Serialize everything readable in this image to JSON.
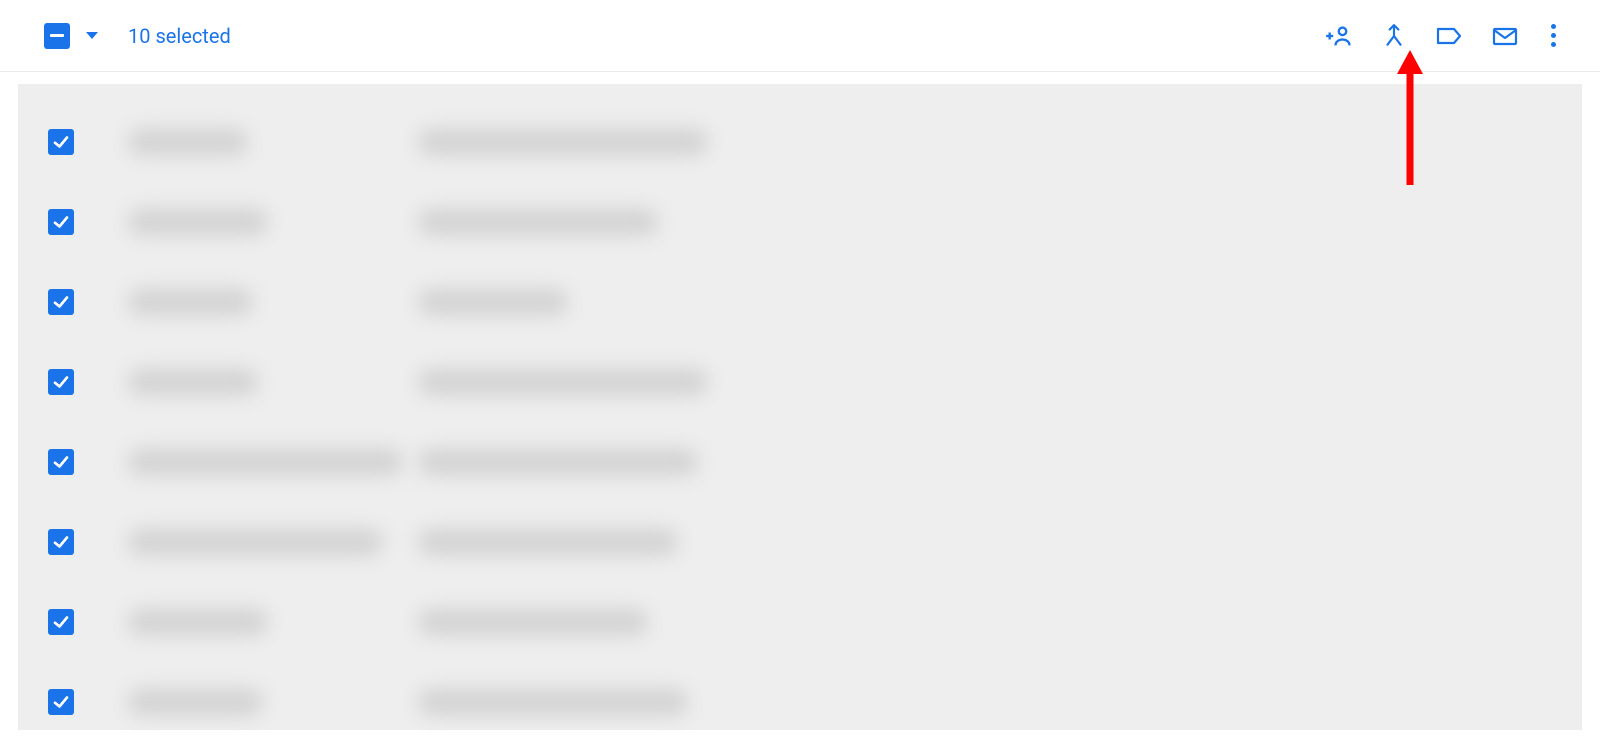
{
  "colors": {
    "primary": "#1a73e8",
    "list_bg": "#eeeeee",
    "blur_fill": "#d4d4d4"
  },
  "toolbar": {
    "selected_label": "10 selected",
    "icons": {
      "add_person": "add-person-icon",
      "merge": "merge-icon",
      "label": "label-icon",
      "mail": "mail-icon",
      "more": "more-vert-icon"
    }
  },
  "annotation": {
    "target": "label-icon",
    "arrow_color": "#ff0000"
  },
  "rows": [
    {
      "checked": true,
      "name_width": 120,
      "email_width": 290
    },
    {
      "checked": true,
      "name_width": 140,
      "email_width": 240
    },
    {
      "checked": true,
      "name_width": 125,
      "email_width": 150
    },
    {
      "checked": true,
      "name_width": 130,
      "email_width": 290
    },
    {
      "checked": true,
      "name_width": 275,
      "email_width": 280
    },
    {
      "checked": true,
      "name_width": 255,
      "email_width": 260
    },
    {
      "checked": true,
      "name_width": 140,
      "email_width": 230
    },
    {
      "checked": true,
      "name_width": 135,
      "email_width": 270
    }
  ]
}
